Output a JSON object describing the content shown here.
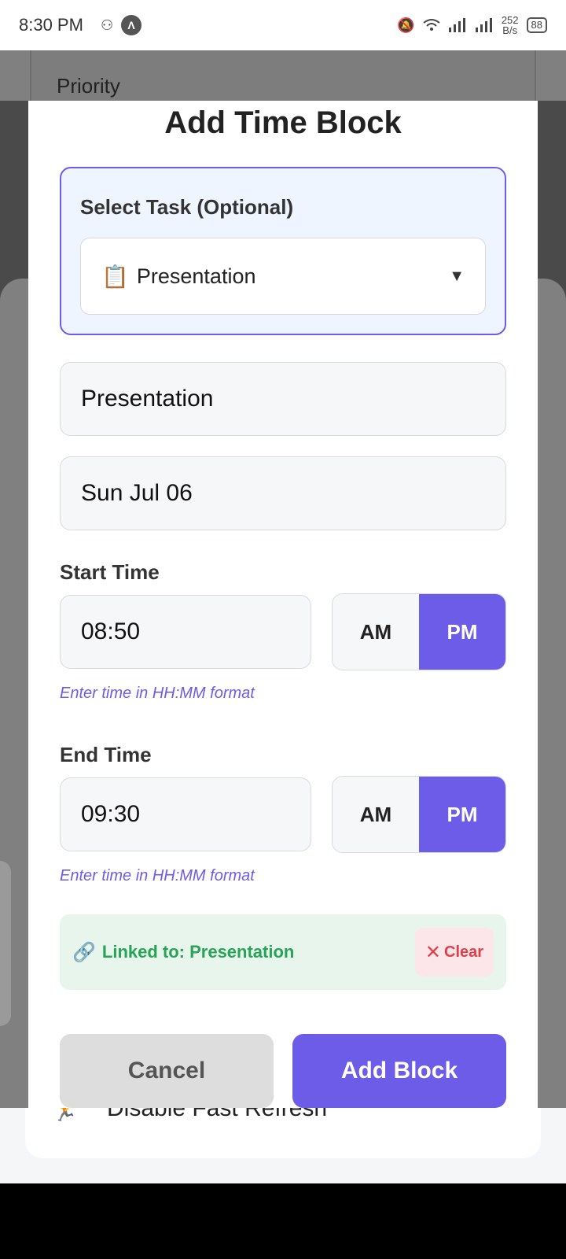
{
  "status_bar": {
    "time": "8:30 PM",
    "nav_glyph": "Λ",
    "net_rate_value": "252",
    "net_rate_unit": "B/s",
    "battery": "88"
  },
  "background": {
    "priority_label": "Priority",
    "disable_fast_refresh": "Disable Fast Refresh"
  },
  "modal": {
    "title": "Add Time Block",
    "task_section_label": "Select Task (Optional)",
    "task_select_value": "Presentation",
    "task_select_icon": "📋",
    "title_field_value": "Presentation",
    "date_field_value": "Sun Jul 06",
    "start": {
      "label": "Start Time",
      "value": "08:50",
      "am": "AM",
      "pm": "PM",
      "selected": "PM",
      "hint": "Enter time in HH:MM format"
    },
    "end": {
      "label": "End Time",
      "value": "09:30",
      "am": "AM",
      "pm": "PM",
      "selected": "PM",
      "hint": "Enter time in HH:MM format"
    },
    "linked_text": "Linked to: Presentation",
    "clear_label": "Clear",
    "cancel_label": "Cancel",
    "add_label": "Add Block"
  },
  "colors": {
    "accent": "#6c5ce7",
    "linked_green": "#27a455",
    "clear_red": "#e0404a"
  }
}
